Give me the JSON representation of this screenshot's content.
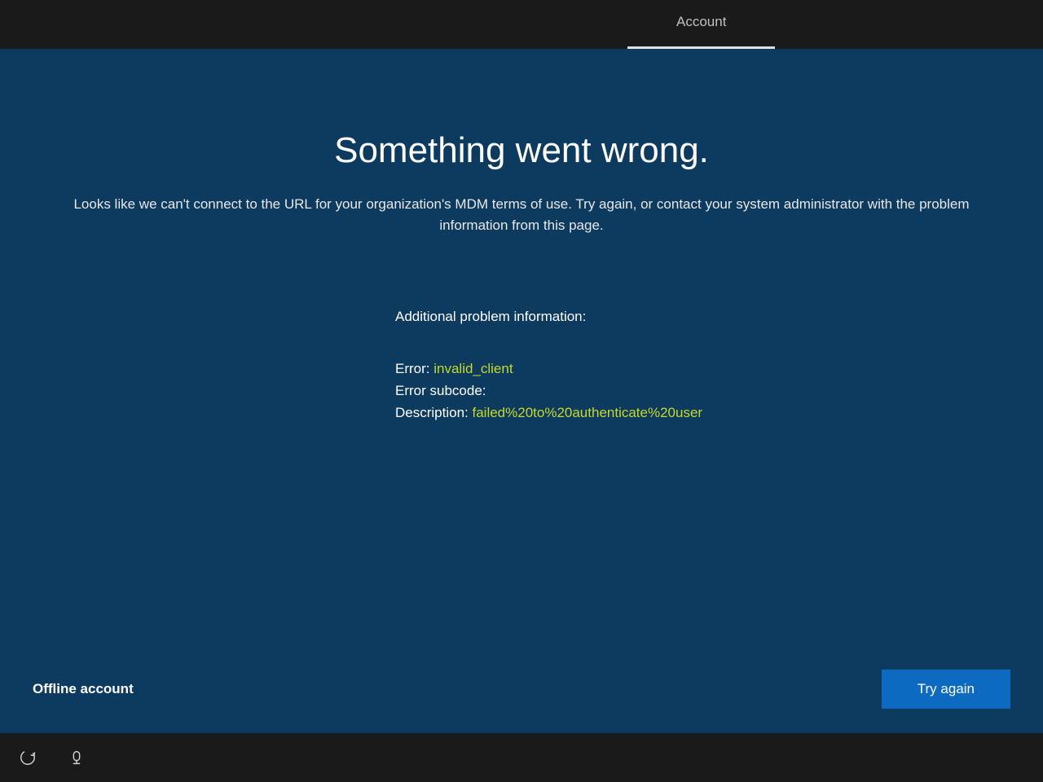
{
  "topbar": {
    "tab_label": "Account"
  },
  "main": {
    "title": "Something went wrong.",
    "subtitle": "Looks like we can't connect to the URL for your organization's MDM terms of use. Try again, or contact your system administrator with the problem information from this page.",
    "problem_header": "Additional problem information:",
    "error_label": "Error: ",
    "error_value": "invalid_client",
    "subcode_label": "Error subcode:",
    "subcode_value": "",
    "description_label": "Description: ",
    "description_value": "failed%20to%20authenticate%20user"
  },
  "footer": {
    "offline_label": "Offline account",
    "try_again_label": "Try again"
  }
}
